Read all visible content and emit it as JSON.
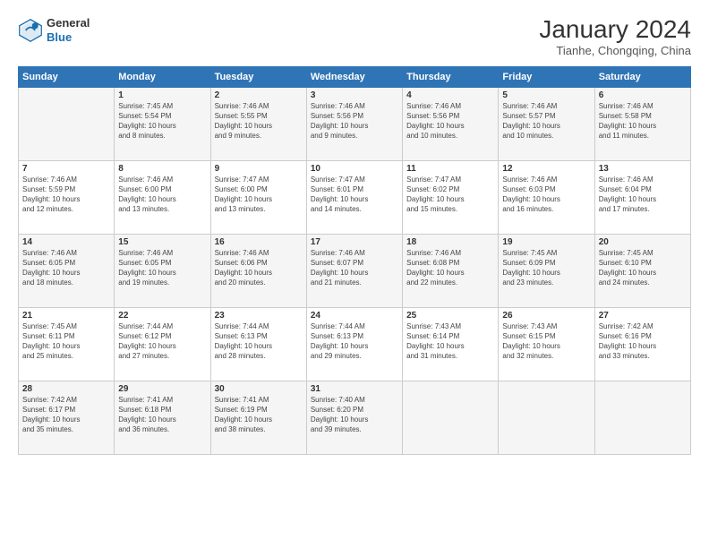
{
  "header": {
    "logo_general": "General",
    "logo_blue": "Blue",
    "title": "January 2024",
    "location": "Tianhe, Chongqing, China"
  },
  "days_of_week": [
    "Sunday",
    "Monday",
    "Tuesday",
    "Wednesday",
    "Thursday",
    "Friday",
    "Saturday"
  ],
  "weeks": [
    [
      {
        "day": "",
        "info": ""
      },
      {
        "day": "1",
        "info": "Sunrise: 7:45 AM\nSunset: 5:54 PM\nDaylight: 10 hours\nand 8 minutes."
      },
      {
        "day": "2",
        "info": "Sunrise: 7:46 AM\nSunset: 5:55 PM\nDaylight: 10 hours\nand 9 minutes."
      },
      {
        "day": "3",
        "info": "Sunrise: 7:46 AM\nSunset: 5:56 PM\nDaylight: 10 hours\nand 9 minutes."
      },
      {
        "day": "4",
        "info": "Sunrise: 7:46 AM\nSunset: 5:56 PM\nDaylight: 10 hours\nand 10 minutes."
      },
      {
        "day": "5",
        "info": "Sunrise: 7:46 AM\nSunset: 5:57 PM\nDaylight: 10 hours\nand 10 minutes."
      },
      {
        "day": "6",
        "info": "Sunrise: 7:46 AM\nSunset: 5:58 PM\nDaylight: 10 hours\nand 11 minutes."
      }
    ],
    [
      {
        "day": "7",
        "info": "Sunrise: 7:46 AM\nSunset: 5:59 PM\nDaylight: 10 hours\nand 12 minutes."
      },
      {
        "day": "8",
        "info": "Sunrise: 7:46 AM\nSunset: 6:00 PM\nDaylight: 10 hours\nand 13 minutes."
      },
      {
        "day": "9",
        "info": "Sunrise: 7:47 AM\nSunset: 6:00 PM\nDaylight: 10 hours\nand 13 minutes."
      },
      {
        "day": "10",
        "info": "Sunrise: 7:47 AM\nSunset: 6:01 PM\nDaylight: 10 hours\nand 14 minutes."
      },
      {
        "day": "11",
        "info": "Sunrise: 7:47 AM\nSunset: 6:02 PM\nDaylight: 10 hours\nand 15 minutes."
      },
      {
        "day": "12",
        "info": "Sunrise: 7:46 AM\nSunset: 6:03 PM\nDaylight: 10 hours\nand 16 minutes."
      },
      {
        "day": "13",
        "info": "Sunrise: 7:46 AM\nSunset: 6:04 PM\nDaylight: 10 hours\nand 17 minutes."
      }
    ],
    [
      {
        "day": "14",
        "info": "Sunrise: 7:46 AM\nSunset: 6:05 PM\nDaylight: 10 hours\nand 18 minutes."
      },
      {
        "day": "15",
        "info": "Sunrise: 7:46 AM\nSunset: 6:05 PM\nDaylight: 10 hours\nand 19 minutes."
      },
      {
        "day": "16",
        "info": "Sunrise: 7:46 AM\nSunset: 6:06 PM\nDaylight: 10 hours\nand 20 minutes."
      },
      {
        "day": "17",
        "info": "Sunrise: 7:46 AM\nSunset: 6:07 PM\nDaylight: 10 hours\nand 21 minutes."
      },
      {
        "day": "18",
        "info": "Sunrise: 7:46 AM\nSunset: 6:08 PM\nDaylight: 10 hours\nand 22 minutes."
      },
      {
        "day": "19",
        "info": "Sunrise: 7:45 AM\nSunset: 6:09 PM\nDaylight: 10 hours\nand 23 minutes."
      },
      {
        "day": "20",
        "info": "Sunrise: 7:45 AM\nSunset: 6:10 PM\nDaylight: 10 hours\nand 24 minutes."
      }
    ],
    [
      {
        "day": "21",
        "info": "Sunrise: 7:45 AM\nSunset: 6:11 PM\nDaylight: 10 hours\nand 25 minutes."
      },
      {
        "day": "22",
        "info": "Sunrise: 7:44 AM\nSunset: 6:12 PM\nDaylight: 10 hours\nand 27 minutes."
      },
      {
        "day": "23",
        "info": "Sunrise: 7:44 AM\nSunset: 6:13 PM\nDaylight: 10 hours\nand 28 minutes."
      },
      {
        "day": "24",
        "info": "Sunrise: 7:44 AM\nSunset: 6:13 PM\nDaylight: 10 hours\nand 29 minutes."
      },
      {
        "day": "25",
        "info": "Sunrise: 7:43 AM\nSunset: 6:14 PM\nDaylight: 10 hours\nand 31 minutes."
      },
      {
        "day": "26",
        "info": "Sunrise: 7:43 AM\nSunset: 6:15 PM\nDaylight: 10 hours\nand 32 minutes."
      },
      {
        "day": "27",
        "info": "Sunrise: 7:42 AM\nSunset: 6:16 PM\nDaylight: 10 hours\nand 33 minutes."
      }
    ],
    [
      {
        "day": "28",
        "info": "Sunrise: 7:42 AM\nSunset: 6:17 PM\nDaylight: 10 hours\nand 35 minutes."
      },
      {
        "day": "29",
        "info": "Sunrise: 7:41 AM\nSunset: 6:18 PM\nDaylight: 10 hours\nand 36 minutes."
      },
      {
        "day": "30",
        "info": "Sunrise: 7:41 AM\nSunset: 6:19 PM\nDaylight: 10 hours\nand 38 minutes."
      },
      {
        "day": "31",
        "info": "Sunrise: 7:40 AM\nSunset: 6:20 PM\nDaylight: 10 hours\nand 39 minutes."
      },
      {
        "day": "",
        "info": ""
      },
      {
        "day": "",
        "info": ""
      },
      {
        "day": "",
        "info": ""
      }
    ]
  ]
}
